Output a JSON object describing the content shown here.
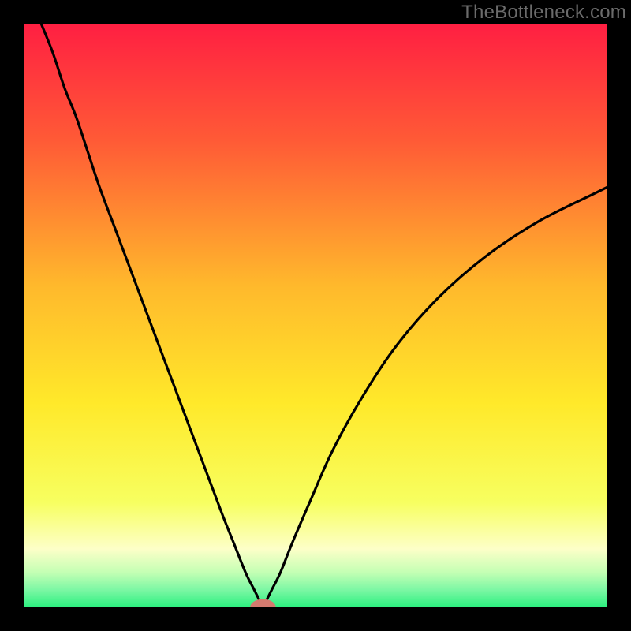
{
  "watermark": "TheBottleneck.com",
  "colors": {
    "bg": "#000000",
    "curve": "#000000",
    "watermark": "#6b6b6b",
    "gradient_stops": [
      {
        "offset": 0.0,
        "color": "#ff1f42"
      },
      {
        "offset": 0.2,
        "color": "#ff5a36"
      },
      {
        "offset": 0.45,
        "color": "#ffb92c"
      },
      {
        "offset": 0.65,
        "color": "#ffe92a"
      },
      {
        "offset": 0.82,
        "color": "#f7ff60"
      },
      {
        "offset": 0.9,
        "color": "#fdffc8"
      },
      {
        "offset": 0.94,
        "color": "#c4ffb4"
      },
      {
        "offset": 0.97,
        "color": "#7cf7a4"
      },
      {
        "offset": 1.0,
        "color": "#2bf07f"
      }
    ],
    "marker_fill": "#d47a6f",
    "marker_stroke": "#9c4f46"
  },
  "chart_data": {
    "type": "line",
    "title": "",
    "xlabel": "",
    "ylabel": "",
    "xlim": [
      0,
      100
    ],
    "ylim": [
      0,
      100
    ],
    "min_point": {
      "x": 41,
      "y": 0
    },
    "marker": {
      "x": 41,
      "y": 0,
      "rx": 2.2,
      "ry": 1.4
    },
    "series": [
      {
        "name": "bottleneck-curve",
        "x": [
          3,
          5,
          7,
          9,
          11,
          13,
          16,
          19,
          22,
          25,
          28,
          31,
          34,
          36,
          38,
          39.5,
          40.5,
          41,
          41.5,
          42.5,
          44,
          46,
          49,
          53,
          58,
          64,
          71,
          79,
          88,
          98,
          100
        ],
        "values": [
          100,
          95,
          89,
          84,
          78,
          72,
          64,
          56,
          48,
          40,
          32,
          24,
          16,
          11,
          6,
          3,
          1,
          0,
          1,
          3,
          6,
          11,
          18,
          27,
          36,
          45,
          53,
          60,
          66,
          71,
          72
        ]
      }
    ]
  }
}
